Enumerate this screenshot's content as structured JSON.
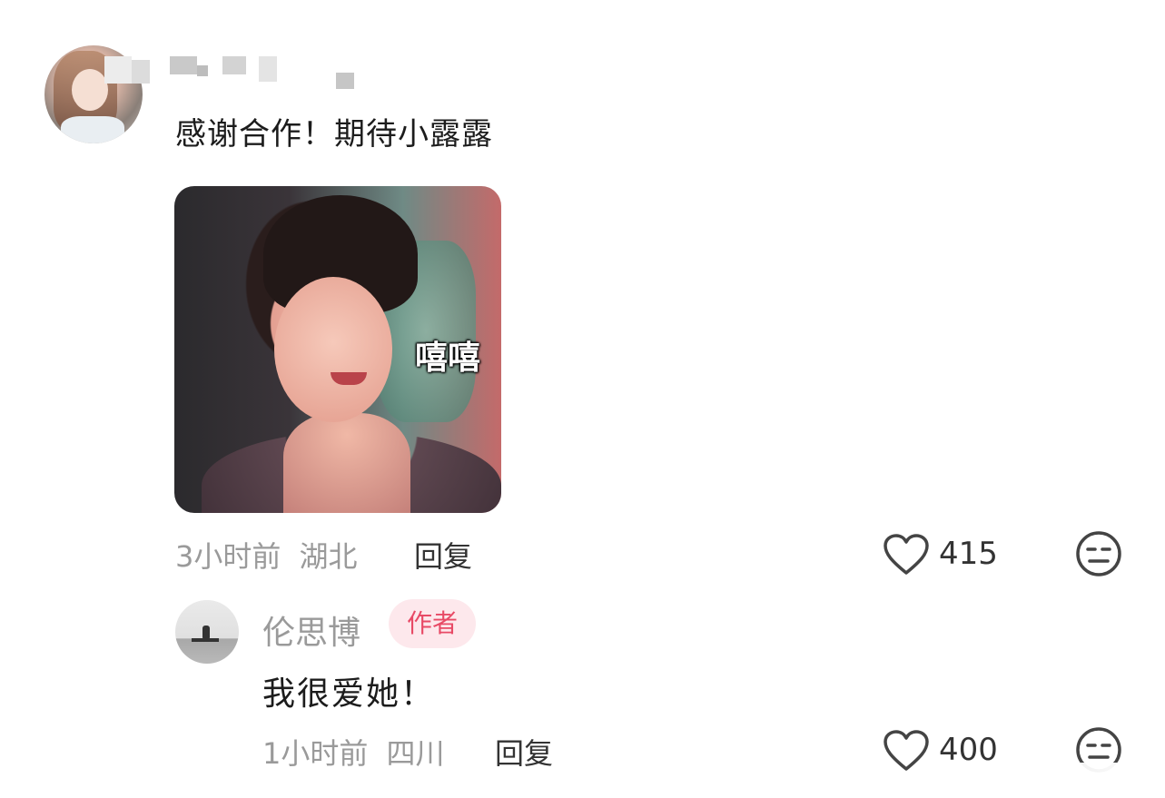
{
  "comment": {
    "username": "",
    "text": "感谢合作！期待小露露",
    "sticker_caption": "嘻嘻",
    "time": "3小时前",
    "location": "湖北",
    "reply_label": "回复",
    "like_count": "415"
  },
  "reply": {
    "username": "伦思博",
    "badge": "作者",
    "text": "我很爱她！",
    "time": "1小时前",
    "location": "四川",
    "reply_label": "回复",
    "like_count": "400"
  },
  "colors": {
    "badge_bg": "#fde8ec",
    "badge_text": "#e84a66",
    "meta_text": "#9a9a9a"
  },
  "icons": {
    "like": "heart-outline-icon",
    "dislike": "neutral-face-icon"
  }
}
